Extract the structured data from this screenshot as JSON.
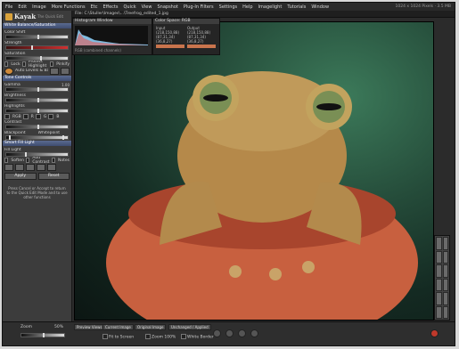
{
  "app": {
    "name": "Kayak",
    "subtitle": "The Quick Edit"
  },
  "menu": [
    "File",
    "Edit",
    "Image",
    "More Functions",
    "Etc",
    "Effects",
    "Quick",
    "View",
    "Snapshot",
    "Plug-In Filters",
    "Settings",
    "Help",
    "Imagelight",
    "Tutorials",
    "Window"
  ],
  "window_info": "1024 x 1024 Pixels · 3.5 MB",
  "file_path": "File: C:\\Stuller\\Images\\...\\Treefrog_edited_1.jpg",
  "sidebar": {
    "panel1": "White Balance/Saturation",
    "rows1": [
      {
        "label": "Color Shift",
        "value": ""
      },
      {
        "label": "Strength",
        "value": ""
      },
      {
        "label": "Saturation",
        "value": ""
      }
    ],
    "options1": [
      "Lock",
      "Protect Highlight",
      "Pinkify"
    ],
    "auto_label": "Auto Levels & Balance",
    "panel2": "Tone Controls",
    "rows2": [
      {
        "label": "Gamma",
        "value": "1.00"
      },
      {
        "label": "Brightness",
        "value": ""
      },
      {
        "label": "Highlights",
        "value": ""
      }
    ],
    "options2": [
      "RGB",
      "R",
      "G",
      "B"
    ],
    "contrast_label": "Contrast",
    "blackpoint": "Blackpoint",
    "whitepoint": "Whitepoint",
    "panel3": "Smart Fill Light",
    "fill_label": "Fill Light",
    "fill_options": [
      "Soften",
      "Add Contrast",
      "Notes"
    ],
    "apply": "Apply",
    "reset": "Reset",
    "help": "Press Cancel or Accept to return to the Quick Edit Mode and to use other functions"
  },
  "histogram": {
    "title": "Histogram Window",
    "footer": "RGB (combined channels)"
  },
  "color_space": {
    "title": "Color Space: RGB",
    "input_label": "Input",
    "output_label": "Output",
    "input_values": [
      "(218,150,88)",
      "(87,31,34)",
      "(36,8,27)"
    ],
    "output_values": [
      "(218,150,88)",
      "(87,31,34)",
      "(36,8,27)"
    ]
  },
  "bottom": {
    "zoom_label": "Zoom",
    "zoom_value": "50%",
    "tabs": [
      "Preview Views",
      "Current Image",
      "Original Image",
      "Unchanged / Applied"
    ],
    "fit_to_screen": "Fit to Screen",
    "zoom_100": "Zoom 100%",
    "white_border": "White Border"
  }
}
